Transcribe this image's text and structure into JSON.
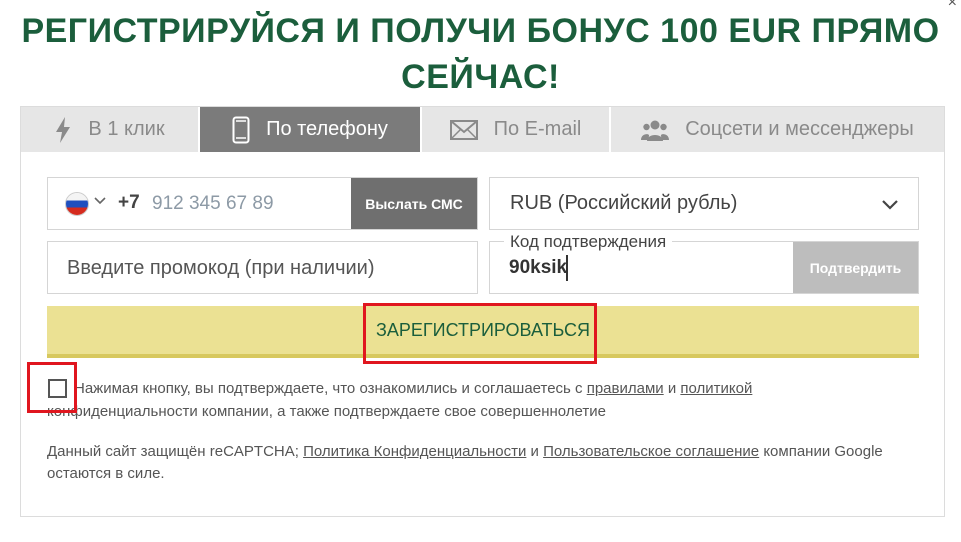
{
  "close_symbol": "×",
  "title": {
    "line1": "РЕГИСТРИРУЙСЯ И ПОЛУЧИ БОНУС 100 EUR ПРЯМО",
    "line2": "СЕЙЧАС!"
  },
  "tabs": [
    {
      "label": "В 1 клик",
      "icon": "lightning-icon",
      "active": false
    },
    {
      "label": "По телефону",
      "icon": "smartphone-icon",
      "active": true
    },
    {
      "label": "По E-mail",
      "icon": "envelope-icon",
      "active": false
    },
    {
      "label": "Соцсети и мессенджеры",
      "icon": "users-icon",
      "active": false
    }
  ],
  "phone": {
    "flag": "russia-flag-icon",
    "country_code": "+7",
    "placeholder": "912 345 67 89",
    "value": "",
    "send_sms_label": "Выслать СМС"
  },
  "currency": {
    "selected": "RUB (Российский рубль)"
  },
  "promo": {
    "placeholder": "Введите промокод (при наличии)"
  },
  "confirmation": {
    "legend": "Код подтверждения",
    "value": "90ksik",
    "confirm_label": "Подтвердить"
  },
  "register_label": "ЗАРЕГИСТРИРОВАТЬСЯ",
  "agreement": {
    "checked": false,
    "text_before": "Нажимая кнопку, вы подтверждаете, что ознакомились и соглашаетесь с ",
    "link_rules": "правилами",
    "and": " и ",
    "link_policy": "политикой",
    "text_after": " конфиденциальности компании, а также подтверждаете свое совершеннолетие"
  },
  "captcha": {
    "text_before": "Данный сайт защищён reCAPTCHA; ",
    "link_privacy": "Политика Конфиденциальности",
    "and": " и ",
    "link_terms": "Пользовательское соглашение",
    "text_after": " компании Google остаются в силе."
  },
  "colors": {
    "title_green": "#1b5e3c",
    "active_tab": "#7b7b7b",
    "register_bg": "#ebe193",
    "highlight_red": "#e0161f"
  }
}
